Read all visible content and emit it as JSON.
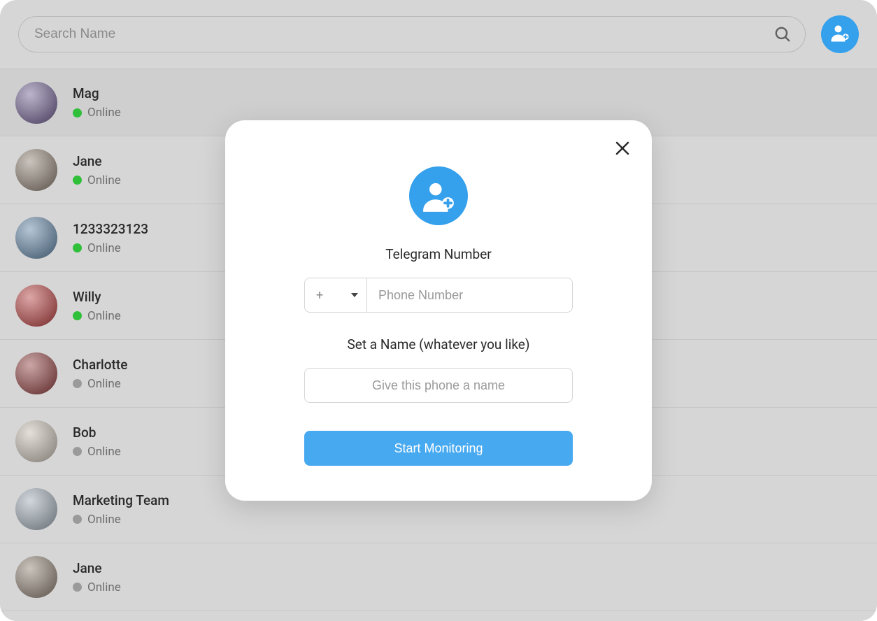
{
  "search": {
    "placeholder": "Search Name"
  },
  "add_button": {
    "icon": "add-user-icon"
  },
  "contacts": [
    {
      "name": "Mag",
      "status": "Online",
      "online": true,
      "avatarBg": "#6b5a8c"
    },
    {
      "name": "Jane",
      "status": "Online",
      "online": true,
      "avatarBg": "#8a7c6e"
    },
    {
      "name": "1233323123",
      "status": "Online",
      "online": true,
      "avatarBg": "#5b7fa0"
    },
    {
      "name": "Willy",
      "status": "Online",
      "online": true,
      "avatarBg": "#b33a3a"
    },
    {
      "name": "Charlotte",
      "status": "Online",
      "online": false,
      "avatarBg": "#8c3a3a"
    },
    {
      "name": "Bob",
      "status": "Online",
      "online": false,
      "avatarBg": "#c2b9ad"
    },
    {
      "name": "Marketing Team",
      "status": "Online",
      "online": false,
      "avatarBg": "#9aa6b1"
    },
    {
      "name": "Jane",
      "status": "Online",
      "online": false,
      "avatarBg": "#8a7c6e"
    }
  ],
  "modal": {
    "title1": "Telegram Number",
    "title2": "Set a Name (whatever you like)",
    "country_prefix": "+",
    "phone_placeholder": "Phone Number",
    "name_placeholder": "Give this phone a name",
    "submit_label": "Start Monitoring"
  },
  "colors": {
    "accent": "#35a0ec",
    "online_green": "#2fbf39",
    "offline_gray": "#9a9a9a"
  }
}
